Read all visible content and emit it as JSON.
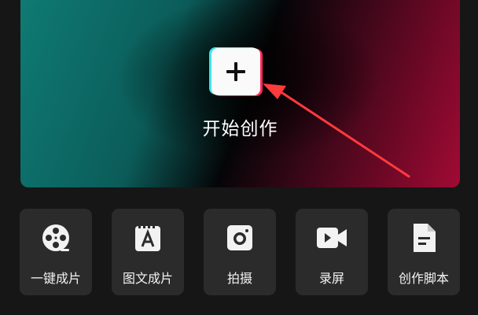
{
  "hero": {
    "start_label": "开始创作",
    "plus_icon": "plus-icon",
    "colors": {
      "teal": "#0f7a73",
      "crimson": "#a10a34",
      "annotation_arrow": "#ff3b3b"
    }
  },
  "tools": [
    {
      "label": "一键成片",
      "icon": "film-reel-icon"
    },
    {
      "label": "图文成片",
      "icon": "text-image-icon"
    },
    {
      "label": "拍摄",
      "icon": "camera-icon"
    },
    {
      "label": "录屏",
      "icon": "video-record-icon"
    },
    {
      "label": "创作脚本",
      "icon": "script-document-icon"
    }
  ]
}
